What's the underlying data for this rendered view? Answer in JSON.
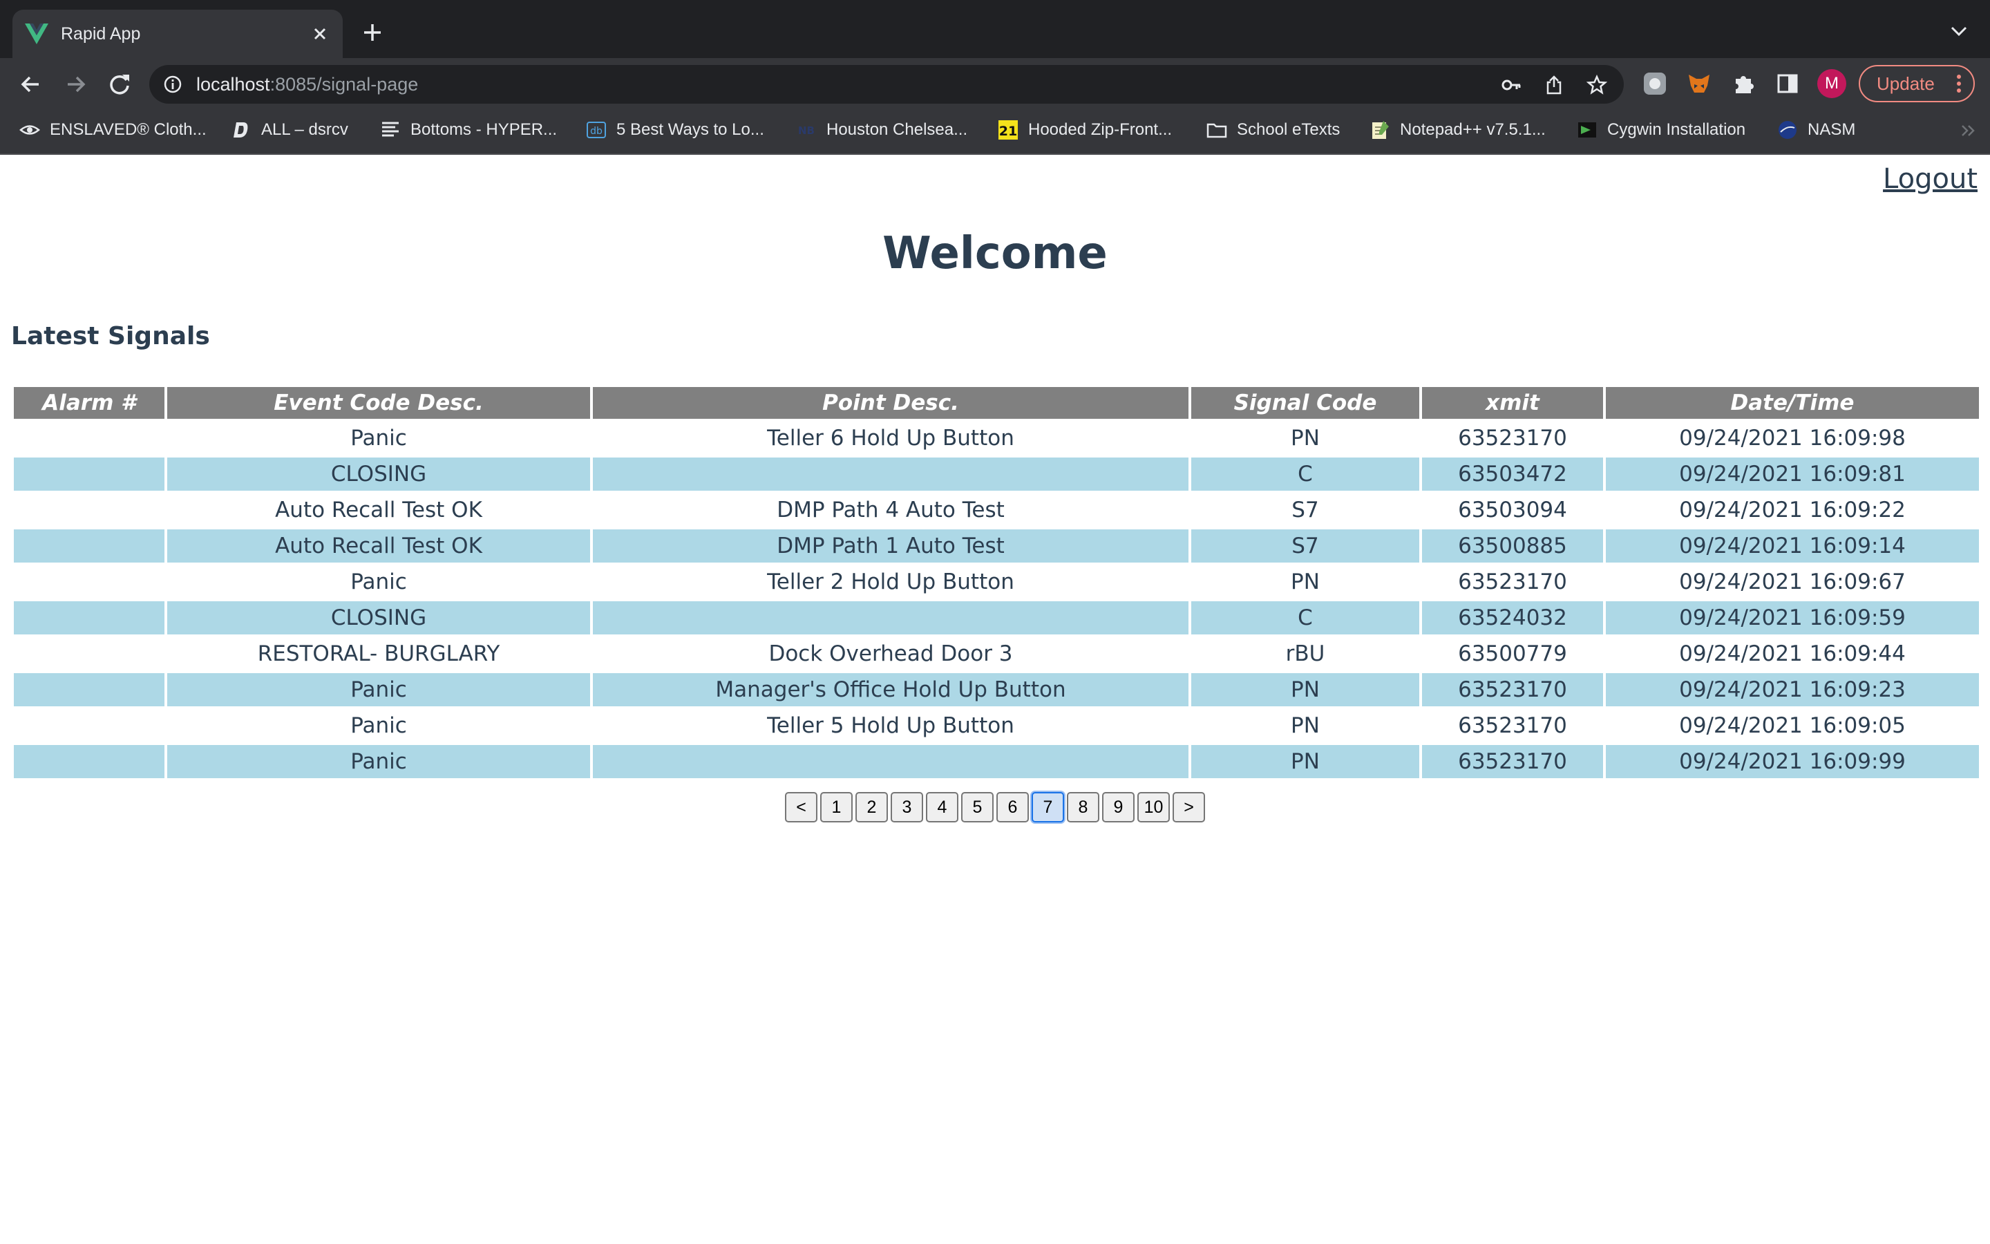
{
  "browser": {
    "tab_title": "Rapid App",
    "url_host": "localhost",
    "url_rest": ":8085/signal-page",
    "profile_initial": "M",
    "update_label": "Update",
    "bookmarks": [
      {
        "label": "ENSLAVED® Cloth...",
        "icon": "eye-logo-icon"
      },
      {
        "label": "ALL – dsrcv",
        "icon": "d-logo-icon"
      },
      {
        "label": "Bottoms - HYPER...",
        "icon": "lines-logo-icon"
      },
      {
        "label": "5 Best Ways to Lo...",
        "icon": "db-logo-icon"
      },
      {
        "label": "Houston Chelsea...",
        "icon": "nb-logo-icon"
      },
      {
        "label": "Hooded Zip-Front...",
        "icon": "21-logo-icon"
      },
      {
        "label": "School eTexts",
        "icon": "folder-icon"
      },
      {
        "label": "Notepad++ v7.5.1...",
        "icon": "notepad-icon"
      },
      {
        "label": "Cygwin Installation",
        "icon": "cygwin-icon"
      },
      {
        "label": "NASM",
        "icon": "nasm-icon"
      }
    ]
  },
  "page": {
    "logout_label": "Logout",
    "welcome": "Welcome",
    "section_title": "Latest Signals"
  },
  "table": {
    "headers": [
      "Alarm #",
      "Event Code Desc.",
      "Point Desc.",
      "Signal Code",
      "xmit",
      "Date/Time"
    ],
    "rows": [
      {
        "alarm": "",
        "event": "Panic",
        "point": "Teller 6 Hold Up Button",
        "signal": "PN",
        "xmit": "63523170",
        "datetime": "09/24/2021 16:09:98"
      },
      {
        "alarm": "",
        "event": "CLOSING",
        "point": "",
        "signal": "C",
        "xmit": "63503472",
        "datetime": "09/24/2021 16:09:81"
      },
      {
        "alarm": "",
        "event": "Auto Recall Test OK",
        "point": "DMP Path 4 Auto Test",
        "signal": "S7",
        "xmit": "63503094",
        "datetime": "09/24/2021 16:09:22"
      },
      {
        "alarm": "",
        "event": "Auto Recall Test OK",
        "point": "DMP Path 1 Auto Test",
        "signal": "S7",
        "xmit": "63500885",
        "datetime": "09/24/2021 16:09:14"
      },
      {
        "alarm": "",
        "event": "Panic",
        "point": "Teller 2 Hold Up Button",
        "signal": "PN",
        "xmit": "63523170",
        "datetime": "09/24/2021 16:09:67"
      },
      {
        "alarm": "",
        "event": "CLOSING",
        "point": "",
        "signal": "C",
        "xmit": "63524032",
        "datetime": "09/24/2021 16:09:59"
      },
      {
        "alarm": "",
        "event": "RESTORAL- BURGLARY",
        "point": "Dock Overhead Door 3",
        "signal": "rBU",
        "xmit": "63500779",
        "datetime": "09/24/2021 16:09:44"
      },
      {
        "alarm": "",
        "event": "Panic",
        "point": "Manager's Office Hold Up Button",
        "signal": "PN",
        "xmit": "63523170",
        "datetime": "09/24/2021 16:09:23"
      },
      {
        "alarm": "",
        "event": "Panic",
        "point": "Teller 5 Hold Up Button",
        "signal": "PN",
        "xmit": "63523170",
        "datetime": "09/24/2021 16:09:05"
      },
      {
        "alarm": "",
        "event": "Panic",
        "point": "",
        "signal": "PN",
        "xmit": "63523170",
        "datetime": "09/24/2021 16:09:99"
      }
    ]
  },
  "pagination": {
    "prev_label": "<",
    "next_label": ">",
    "pages": [
      "1",
      "2",
      "3",
      "4",
      "5",
      "6",
      "7",
      "8",
      "9",
      "10"
    ],
    "current": "7"
  },
  "colors": {
    "header_bg": "#808080",
    "alt_row_bg": "#add8e6",
    "text": "#2c3e50"
  }
}
